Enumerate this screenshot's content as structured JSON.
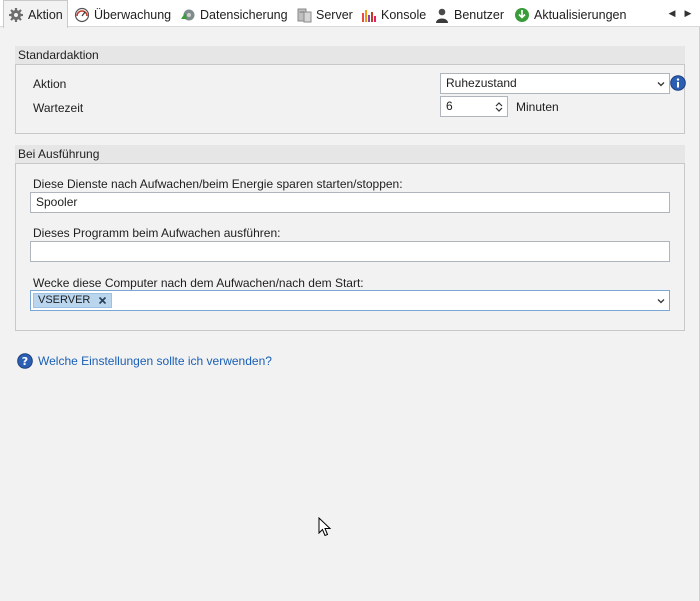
{
  "tabs": [
    {
      "label": "Aktion",
      "icon": "gear-icon"
    },
    {
      "label": "Überwachung",
      "icon": "gauge-icon"
    },
    {
      "label": "Datensicherung",
      "icon": "backup-icon"
    },
    {
      "label": "Server",
      "icon": "server-icon"
    },
    {
      "label": "Konsole",
      "icon": "chart-icon"
    },
    {
      "label": "Benutzer",
      "icon": "user-icon"
    },
    {
      "label": "Aktualisierungen",
      "icon": "update-icon"
    }
  ],
  "standard": {
    "header": "Standardaktion",
    "action_label": "Aktion",
    "action_value": "Ruhezustand",
    "wait_label": "Wartezeit",
    "wait_value": "6",
    "wait_unit": "Minuten"
  },
  "execution": {
    "header": "Bei Ausführung",
    "services_label": "Diese Dienste nach Aufwachen/beim Energie sparen starten/stoppen:",
    "services_value": "Spooler",
    "program_label": "Dieses Programm beim Aufwachen ausführen:",
    "program_value": "",
    "wake_label": "Wecke diese Computer nach dem Aufwachen/nach dem Start:",
    "wake_chip": "VSERVER"
  },
  "help_link": "Welche Einstellungen sollte ich verwenden?",
  "colors": {
    "accent": "#1a5fb4",
    "chip": "#b9d6ee"
  }
}
